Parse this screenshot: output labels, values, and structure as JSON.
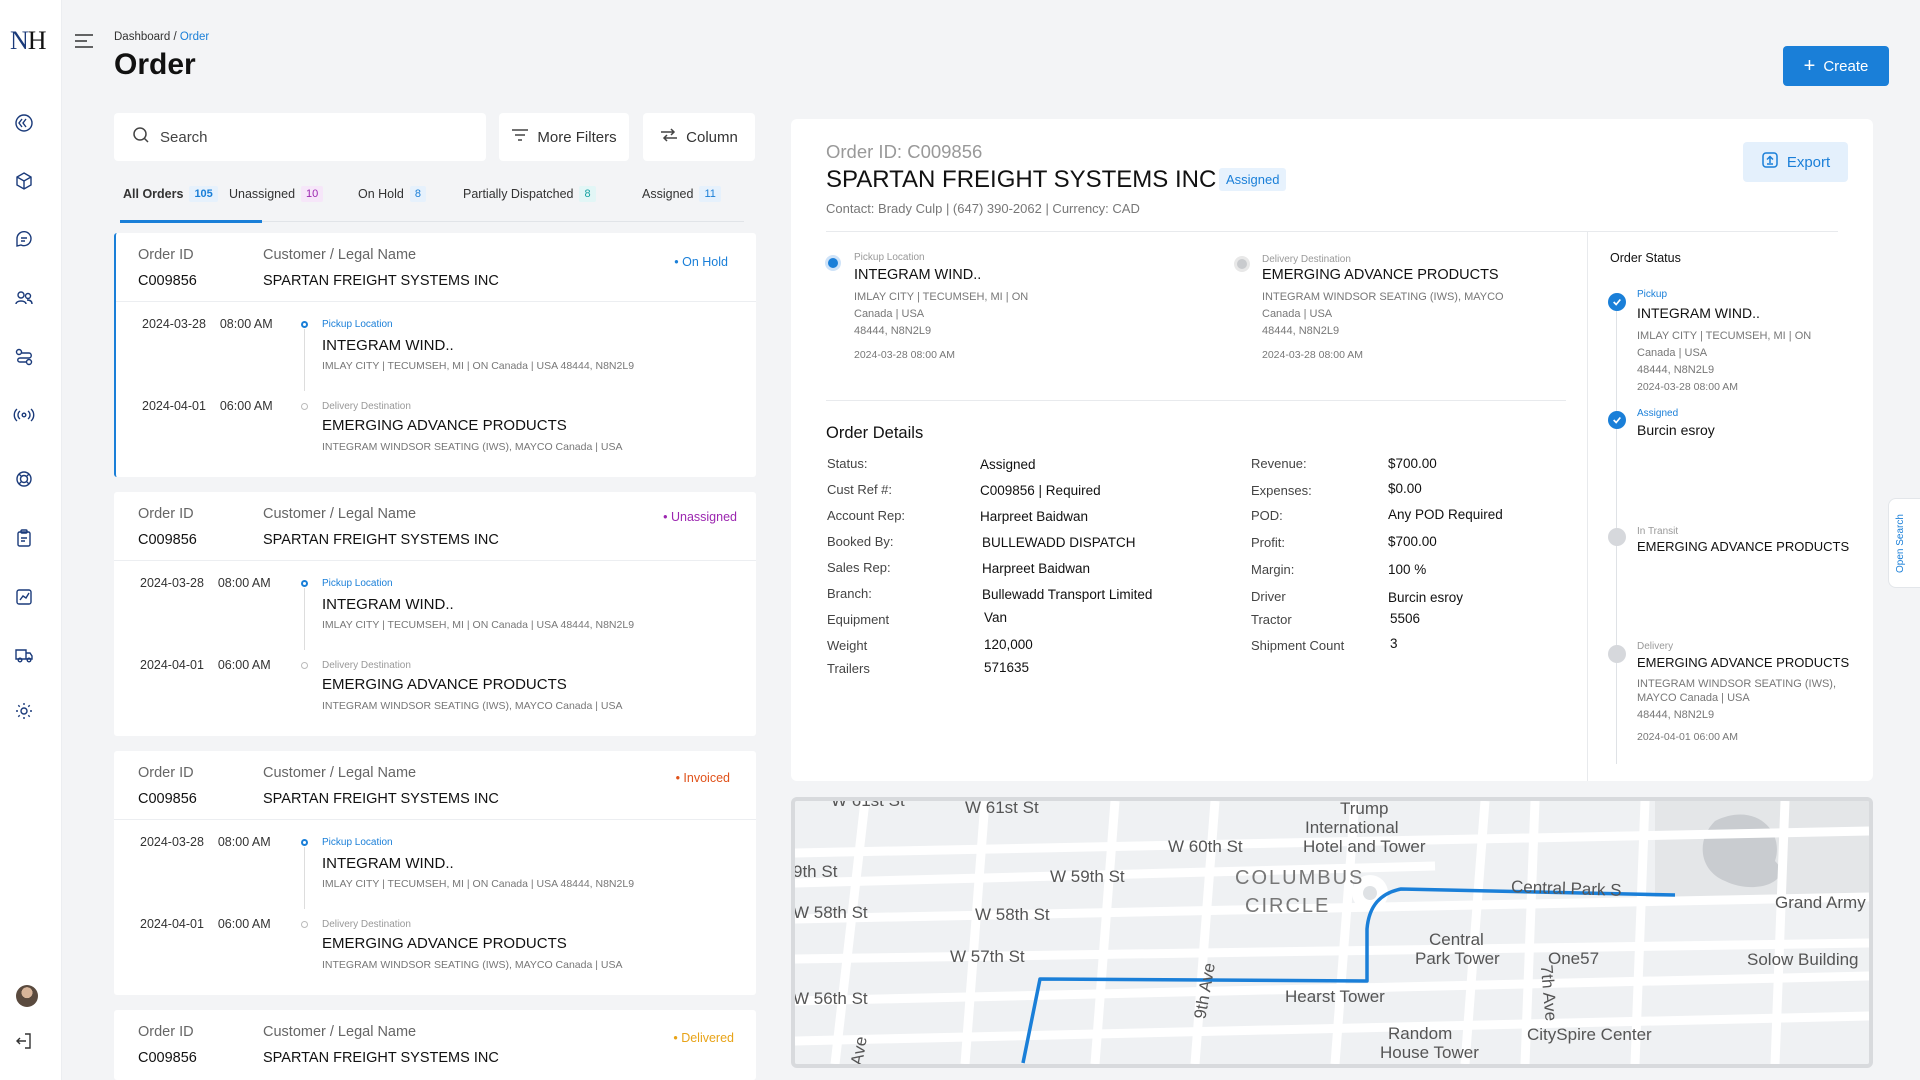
{
  "logo": {
    "left": "N",
    "right": "H"
  },
  "breadcrumb": {
    "root": "Dashboard",
    "sep": " / ",
    "current": "Order"
  },
  "page_title": "Order",
  "create_label": "Create",
  "search": {
    "placeholder": "Search"
  },
  "filters": {
    "more_filters": "More Filters",
    "column": "Column"
  },
  "tabs": [
    {
      "label": "All Orders",
      "count": "105",
      "color": "#1a7fd8",
      "bg": "#e6f1fc"
    },
    {
      "label": "Unassigned",
      "count": "10",
      "color": "#9c27b0",
      "bg": "#f6e6f9"
    },
    {
      "label": "On Hold",
      "count": "8",
      "color": "#1a7fd8",
      "bg": "#e6f1fc"
    },
    {
      "label": "Partially Dispatched",
      "count": "8",
      "color": "#16a3a3",
      "bg": "#e2f6f6"
    },
    {
      "label": "Assigned",
      "count": "11",
      "color": "#1a7fd8",
      "bg": "#e6f1fc"
    }
  ],
  "list_labels": {
    "order_id": "Order ID",
    "customer": "Customer / Legal Name",
    "pickup": "Pickup Location",
    "delivery": "Delivery Destination"
  },
  "orders": [
    {
      "id": "C009856",
      "customer": "SPARTAN FREIGHT SYSTEMS INC",
      "status": "• On Hold",
      "status_color": "#1a7fd8",
      "pickup_date": "2024-03-28",
      "pickup_time": "08:00 AM",
      "pickup_name": "INTEGRAM WIND..",
      "pickup_addr": "IMLAY CITY | TECUMSEH, MI | ON   Canada | USA   48444, N8N2L9",
      "delivery_date": "2024-04-01",
      "delivery_time": "06:00 AM",
      "delivery_name": "EMERGING ADVANCE PRODUCTS",
      "delivery_addr": "INTEGRAM WINDSOR SEATING (IWS), MAYCO   Canada | USA"
    },
    {
      "id": "C009856",
      "customer": "SPARTAN FREIGHT SYSTEMS INC",
      "status": "• Unassigned",
      "status_color": "#9c27b0",
      "pickup_date": "2024-03-28",
      "pickup_time": "08:00 AM",
      "pickup_name": "INTEGRAM WIND..",
      "pickup_addr": "IMLAY CITY | TECUMSEH, MI | ON   Canada | USA   48444, N8N2L9",
      "delivery_date": "2024-04-01",
      "delivery_time": "06:00 AM",
      "delivery_name": "EMERGING ADVANCE PRODUCTS",
      "delivery_addr": "INTEGRAM WINDSOR SEATING (IWS), MAYCO   Canada | USA"
    },
    {
      "id": "C009856",
      "customer": "SPARTAN FREIGHT SYSTEMS INC",
      "status": "• Invoiced",
      "status_color": "#e0521a",
      "pickup_date": "2024-03-28",
      "pickup_time": "08:00 AM",
      "pickup_name": "INTEGRAM WIND..",
      "pickup_addr": "IMLAY CITY | TECUMSEH, MI | ON   Canada | USA   48444, N8N2L9",
      "delivery_date": "2024-04-01",
      "delivery_time": "06:00 AM",
      "delivery_name": "EMERGING ADVANCE PRODUCTS",
      "delivery_addr": "INTEGRAM WINDSOR SEATING (IWS), MAYCO   Canada | USA"
    },
    {
      "id": "C009856",
      "customer": "SPARTAN FREIGHT SYSTEMS INC",
      "status": "• Delivered",
      "status_color": "#e8a317"
    }
  ],
  "detail": {
    "order_id": "Order ID: C009856",
    "company": "SPARTAN FREIGHT SYSTEMS INC",
    "badge": "Assigned",
    "contact": "Contact: Brady Culp | (647) 390-2062 | Currency: CAD",
    "export_label": "Export",
    "pickup": {
      "sub": "Pickup Location",
      "name": "INTEGRAM WIND..",
      "addr1": "IMLAY CITY | TECUMSEH, MI | ON",
      "addr2": "Canada | USA",
      "addr3": "48444, N8N2L9",
      "date": "2024-03-28      08:00 AM"
    },
    "delivery": {
      "sub": "Delivery Destination",
      "name": "EMERGING ADVANCE PRODUCTS",
      "addr1": "INTEGRAM WINDSOR SEATING (IWS), MAYCO",
      "addr2": "Canada | USA",
      "addr3": "48444, N8N2L9",
      "date": "2024-03-28      08:00 AM"
    },
    "details_title": "Order Details",
    "left_fields": [
      {
        "label": "Status:",
        "value": "Assigned"
      },
      {
        "label": "Cust Ref #:",
        "value": "C009856 | Required"
      },
      {
        "label": "Account Rep:",
        "value": "Harpreet Baidwan"
      },
      {
        "label": "Booked By:",
        "value": "BULLEWADD DISPATCH"
      },
      {
        "label": "Sales Rep:",
        "value": "Harpreet Baidwan"
      },
      {
        "label": "Branch:",
        "value": "Bullewadd Transport Limited"
      },
      {
        "label": "Equipment",
        "value": "Van"
      },
      {
        "label": "Weight",
        "value": "120,000"
      },
      {
        "label": "Trailers",
        "value": "571635"
      }
    ],
    "right_fields": [
      {
        "label": "Revenue:",
        "value": "$700.00"
      },
      {
        "label": "Expenses:",
        "value": "$0.00"
      },
      {
        "label": "POD:",
        "value": "Any POD Required"
      },
      {
        "label": "Profit:",
        "value": "$700.00"
      },
      {
        "label": "Margin:",
        "value": "100 %"
      },
      {
        "label": "Driver",
        "value": "Burcin esroy"
      },
      {
        "label": "Tractor",
        "value": "5506"
      },
      {
        "label": "Shipment Count",
        "value": "3"
      }
    ]
  },
  "order_status": {
    "title": "Order Status",
    "steps": [
      {
        "sub": "Pickup",
        "name": "INTEGRAM WIND..",
        "addr": [
          "IMLAY CITY | TECUMSEH, MI | ON",
          "Canada | USA",
          "48444, N8N2L9",
          "2024-03-28 08:00 AM"
        ]
      },
      {
        "sub": "Assigned",
        "name": "Burcin esroy"
      },
      {
        "sub": "In Transit",
        "name": "EMERGING ADVANCE PRODUCTS"
      },
      {
        "sub": "Delivery",
        "name": "EMERGING ADVANCE PRODUCTS",
        "addr": [
          "INTEGRAM WINDSOR SEATING (IWS),",
          "MAYCO  Canada | USA",
          "48444, N8N2L9",
          "2024-04-01  06:00 AM"
        ]
      }
    ]
  },
  "open_search": "Open Search",
  "map": {
    "labels": [
      "W 61st St",
      "W 61st St",
      "Trump",
      "International",
      "Hotel and Tower",
      "W 60th St",
      "9th St",
      "W 59th St",
      "COLUMBUS",
      "CIRCLE",
      "Central Park S",
      "Grand Army",
      "W 58th St",
      "W 58th St",
      "Central",
      "Park Tower",
      "One57",
      "Solow Building",
      "W 57th St",
      "9th Ave",
      "7th Ave",
      "Hearst Tower",
      "W 56th St",
      "Random",
      "House Tower",
      "CitySpire Center",
      "Ave"
    ]
  },
  "colors": {
    "accent": "#1a7fd8",
    "route": "#1a7fd8"
  }
}
